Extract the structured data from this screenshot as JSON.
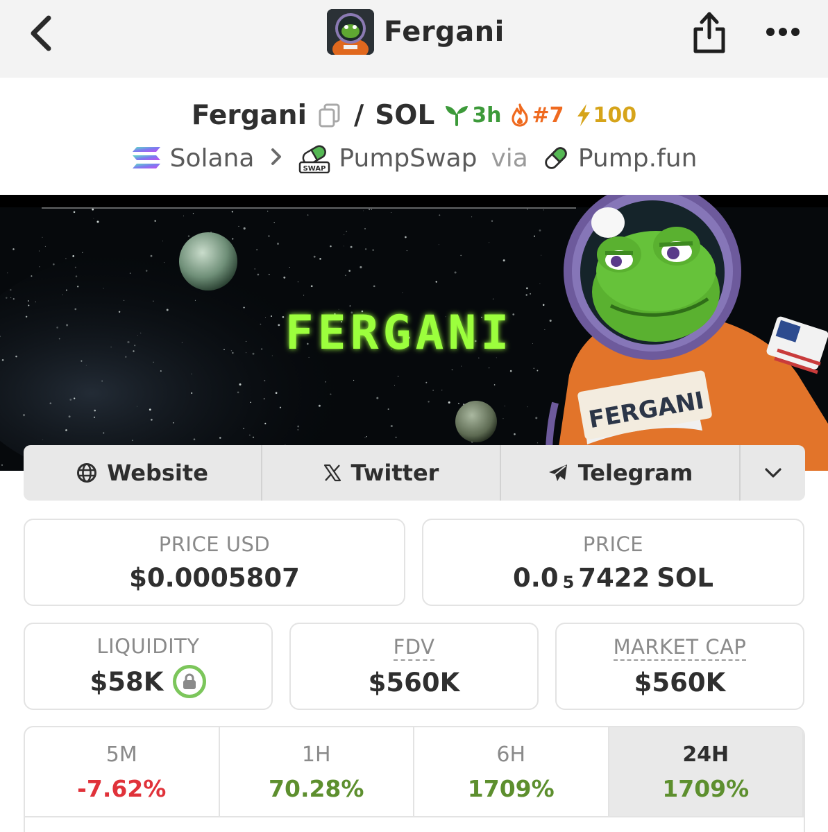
{
  "nav": {
    "title": "Fergani"
  },
  "pair": {
    "base": "Fergani",
    "separator": "/",
    "quote": "SOL",
    "age": "3h",
    "rank": "#7",
    "boosts": "100"
  },
  "chain": {
    "network": "Solana",
    "dex": "PumpSwap",
    "via": "via",
    "launchpad": "Pump.fun",
    "swap_badge": "SWAP"
  },
  "banner": {
    "logo_text": "FERGANI",
    "suit_name": "FERGANI"
  },
  "links": {
    "website": "Website",
    "twitter": "Twitter",
    "telegram": "Telegram"
  },
  "stats": {
    "price_usd": {
      "label": "PRICE USD",
      "value": "$0.0005807"
    },
    "price_native": {
      "label": "PRICE",
      "prefix": "0.0",
      "zeros": "5",
      "digits": "7422",
      "unit": "SOL"
    },
    "liquidity": {
      "label": "LIQUIDITY",
      "value": "$58K"
    },
    "fdv": {
      "label": "FDV",
      "value": "$560K"
    },
    "market_cap": {
      "label": "MARKET CAP",
      "value": "$560K"
    }
  },
  "changes": [
    {
      "timeframe": "5M",
      "value": "-7.62%",
      "direction": "negative"
    },
    {
      "timeframe": "1H",
      "value": "70.28%",
      "direction": "positive"
    },
    {
      "timeframe": "6H",
      "value": "1709%",
      "direction": "positive"
    },
    {
      "timeframe": "24H",
      "value": "1709%",
      "direction": "positive",
      "selected": true
    }
  ],
  "colors": {
    "positive": "#5d8f2e",
    "negative": "#e0323a",
    "age_badge": "#3d9a3a",
    "rank_badge": "#ef6a1f",
    "boost_badge": "#d6a41a",
    "lock_ring": "#7cc65b"
  },
  "icons": [
    "back-icon",
    "share-icon",
    "more-icon",
    "copy-icon",
    "sprout-icon",
    "flame-icon",
    "lightning-icon",
    "solana-icon",
    "chevron-right-icon",
    "pumpswap-icon",
    "pill-icon",
    "globe-icon",
    "x-icon",
    "telegram-icon",
    "chevron-down-icon",
    "lock-icon"
  ]
}
